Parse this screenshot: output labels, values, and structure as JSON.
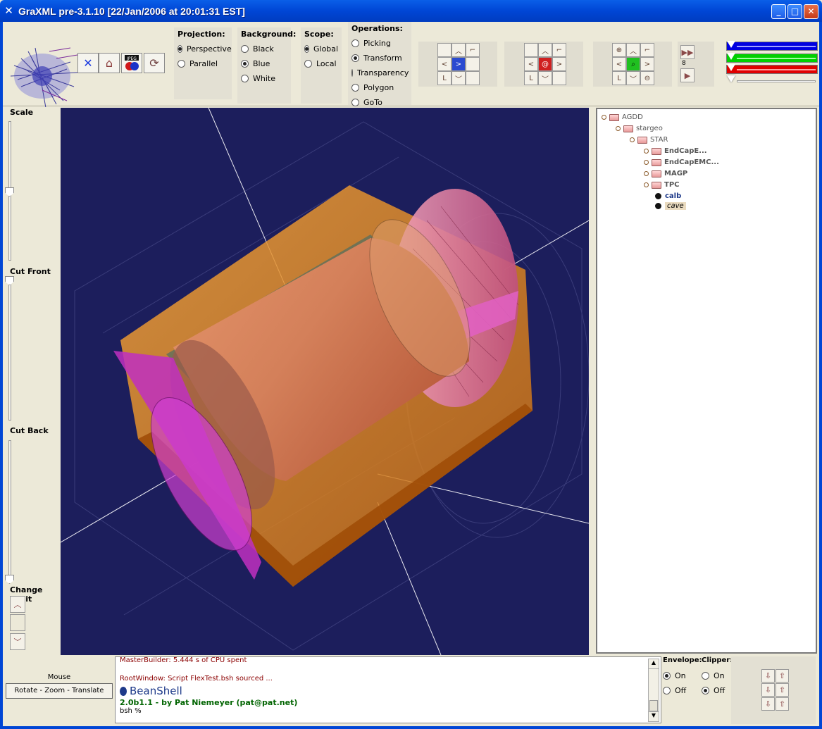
{
  "window": {
    "title": "GraXML pre-3.1.10 [22/Jan/2006 at 20:01:31 EST]",
    "minimize": "_",
    "maximize": "□",
    "close": "✕"
  },
  "toolbar": {
    "buttons": [
      {
        "name": "close-x-button",
        "glyph": "✕"
      },
      {
        "name": "home-button",
        "glyph": "⌂"
      },
      {
        "name": "jpeg-export-button",
        "glyph": "JPEG"
      },
      {
        "name": "refresh-button",
        "glyph": "⟳"
      }
    ],
    "projection": {
      "label": "Projection:",
      "options": [
        "Perspective",
        "Parallel"
      ],
      "selected": "Perspective"
    },
    "background": {
      "label": "Background:",
      "options": [
        "Black",
        "Blue",
        "White"
      ],
      "selected": "Blue"
    },
    "scope": {
      "label": "Scope:",
      "options": [
        "Global",
        "Local"
      ],
      "selected": "Global"
    },
    "operations": {
      "label": "Operations:",
      "options": [
        "Picking",
        "Transform",
        "Transparency",
        "Polygon",
        "GoTo"
      ],
      "selected": "Transform"
    },
    "step_value": "8",
    "color_sliders": {
      "colors": [
        "#0000e0",
        "#00d000",
        "#e00000",
        "#e8e8e8"
      ]
    }
  },
  "left_panel": {
    "scale_label": "Scale",
    "cut_front_label": "Cut Front",
    "cut_back_label": "Cut Back",
    "change_limit_label": "Change Limit"
  },
  "tree": {
    "nodes": [
      {
        "label": "AGDD",
        "type": "folder",
        "level": 0
      },
      {
        "label": "stargeo",
        "type": "folder",
        "level": 1
      },
      {
        "label": "STAR",
        "type": "folder",
        "level": 2
      },
      {
        "label": "EndCapE...",
        "type": "folder",
        "level": 3
      },
      {
        "label": "EndCapEMC...",
        "type": "folder",
        "level": 3
      },
      {
        "label": "MAGP",
        "type": "folder",
        "level": 3
      },
      {
        "label": "TPC",
        "type": "folder",
        "level": 3
      },
      {
        "label": "calb",
        "type": "leaf",
        "level": 3
      },
      {
        "label": "cave",
        "type": "leaf",
        "level": 3
      }
    ]
  },
  "bottom": {
    "mouse_label": "Mouse",
    "mouse_mode": "Rotate - Zoom - Translate",
    "console_lines": [
      "MasterBuilder: 5.444 s of CPU spent",
      "RootWindow: Script FlexTest.bsh sourced ..."
    ],
    "beanshell": "BeanShell",
    "version": "2.0b1.1 - by Pat Niemeyer (pat@pat.net)",
    "prompt": "bsh %",
    "envelope": {
      "label": "Envelope:",
      "on": "On",
      "off": "Off",
      "selected": "On"
    },
    "clipper": {
      "label": "Clipper:",
      "on": "On",
      "off": "Off",
      "selected": "Off"
    }
  }
}
